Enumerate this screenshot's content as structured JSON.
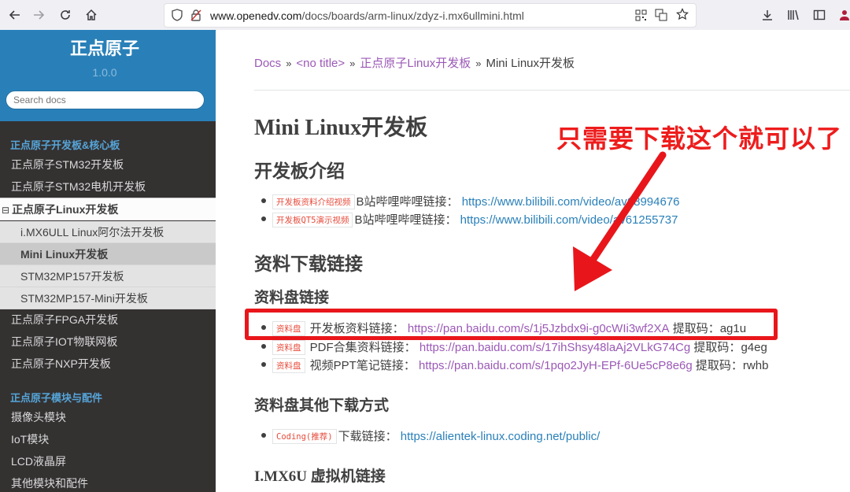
{
  "browser": {
    "url_host": "www.openedv.com",
    "url_path": "/docs/boards/arm-linux/zdyz-i.mx6ullmini.html"
  },
  "sidebar": {
    "brand": "正点原子",
    "version": "1.0.0",
    "search_placeholder": "Search docs",
    "caption_1": "正点原子开发板&核心板",
    "items_1": [
      "正点原子STM32开发板",
      "正点原子STM32电机开发板"
    ],
    "current_label": "正点原子Linux开发板",
    "expander": "⊟",
    "sub_items": [
      "i.MX6ULL Linux阿尔法开发板",
      "Mini Linux开发板",
      "STM32MP157开发板",
      "STM32MP157-Mini开发板"
    ],
    "items_2": [
      "正点原子FPGA开发板",
      "正点原子IOT物联网板",
      "正点原子NXP开发板"
    ],
    "caption_2": "正点原子模块与配件",
    "items_3": [
      "摄像头模块",
      "IoT模块",
      "LCD液晶屏",
      "其他模块和配件"
    ]
  },
  "breadcrumb": {
    "home": "Docs",
    "sep": "»",
    "level_1": "<no title>",
    "level_2": "正点原子Linux开发板",
    "current": "Mini Linux开发板"
  },
  "content": {
    "title": "Mini Linux开发板",
    "section_intro": "开发板介绍",
    "intro_items": [
      {
        "tag": "开发板资料介绍视频",
        "text": "B站哔哩哔哩链接：",
        "link": "https://www.bilibili.com/video/av68994676"
      },
      {
        "tag": "开发板QT5演示视频",
        "text": "B站哔哩哔哩链接：",
        "link": "https://www.bilibili.com/video/av61255737"
      }
    ],
    "section_download": "资料下载链接",
    "subsection_pan": "资料盘链接",
    "pan_items": [
      {
        "tag": "资料盘",
        "text": "开发板资料链接：",
        "link": "https://pan.baidu.com/s/1j5Jzbdx9i-g0cWIi3wf2XA",
        "code_label": "提取码：",
        "code": "ag1u"
      },
      {
        "tag": "资料盘",
        "text": "PDF合集资料链接：",
        "link": "https://pan.baidu.com/s/17ihShsy48laAj2VLkG74Cg",
        "code_label": "提取码：",
        "code": "g4eg"
      },
      {
        "tag": "资料盘",
        "text": "视频PPT笔记链接：",
        "link": "https://pan.baidu.com/s/1pqo2JyH-EPf-6Ue5cP8e6g",
        "code_label": "提取码：",
        "code": "rwhb"
      }
    ],
    "subsection_other": "资料盘其他下载方式",
    "other_items": [
      {
        "tag": "Coding(推荐)",
        "text": "下载链接：",
        "link": "https://alientek-linux.coding.net/public/"
      }
    ],
    "section_vm": "I.MX6U 虚拟机链接"
  },
  "annotation": {
    "text": "只需要下载这个就可以了",
    "color": "#ee1c1c"
  }
}
